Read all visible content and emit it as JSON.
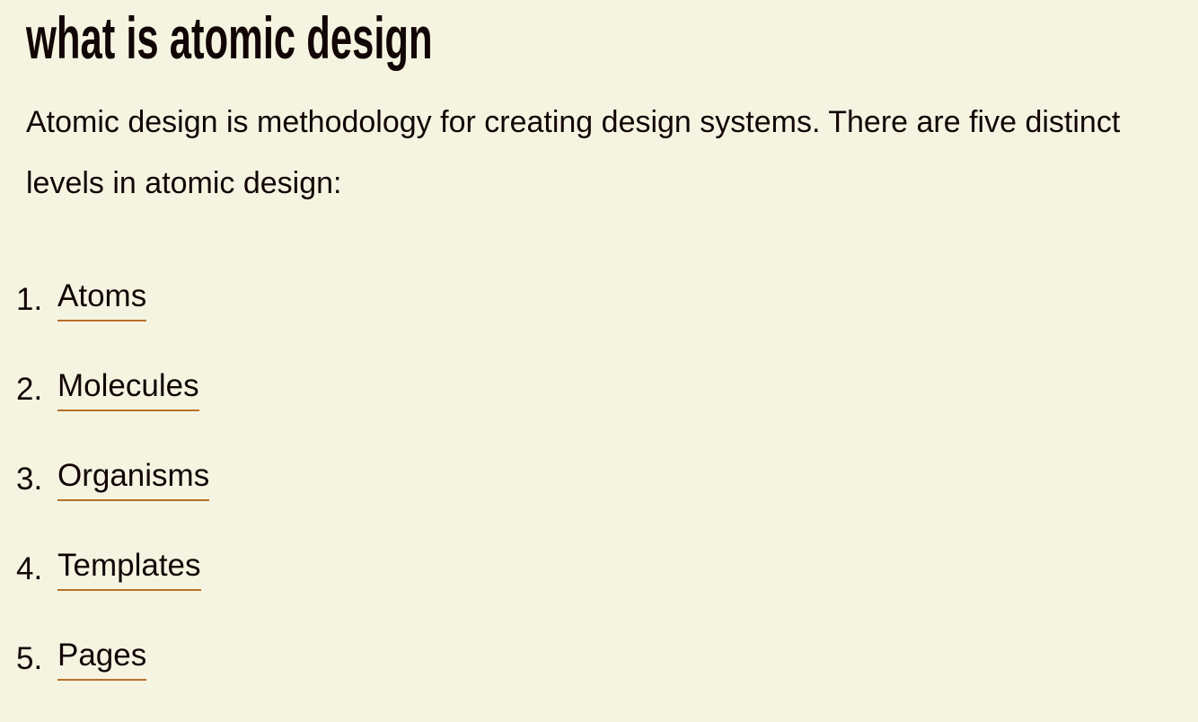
{
  "title": "what is atomic design",
  "intro": "Atomic design is methodology for creating design systems. There are five distinct levels in atomic design:",
  "link_underline_color": "#b8702a",
  "levels": [
    {
      "number": "1.",
      "label": "Atoms"
    },
    {
      "number": "2.",
      "label": "Molecules"
    },
    {
      "number": "3.",
      "label": "Organisms"
    },
    {
      "number": "4.",
      "label": "Templates"
    },
    {
      "number": "5.",
      "label": "Pages"
    }
  ]
}
